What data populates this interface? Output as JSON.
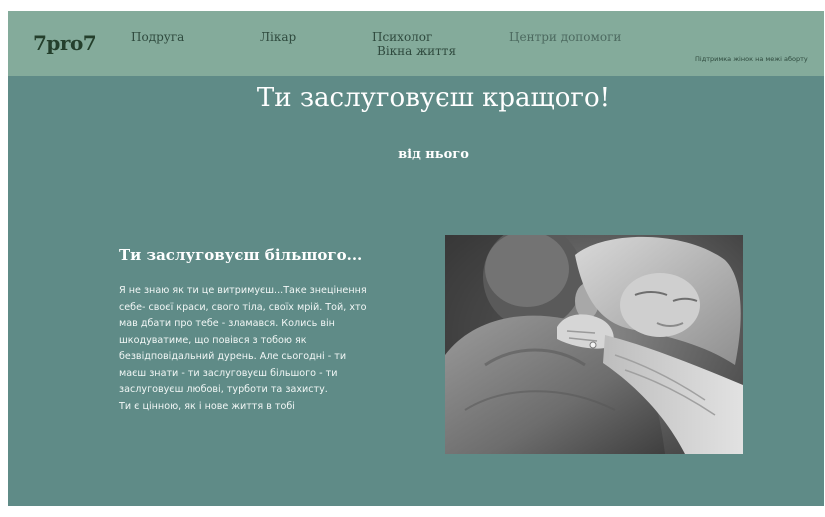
{
  "header": {
    "logo": "7pro7",
    "nav": {
      "friend": "Подруга",
      "doctor": "Лікар",
      "psychologist": "Психолог",
      "windows_of_life": "Вікна життя",
      "help_centers": "Центри допомоги",
      "support": "Підтримка жінок на межі аборту"
    }
  },
  "hero": {
    "title": "Ти заслуговуєш кращого!",
    "subtitle": "від нього"
  },
  "content": {
    "heading": "Ти заслуговуєш більшого...",
    "paragraph": "Я не знаю як ти це витримуєш...Таке знецінення себе- своєї краси, свого тіла, своїх мрій. Той, хто мав дбати про тебе - зламався. Колись він шкодуватиме, що повівся з тобою як безвідповідальний дурень. Але сьогодні - ти маєш знати - ти заслуговуєш більшого - ти заслуговуєш любові, турботи та захисту.",
    "closing": "Ти є цінною, як і нове життя в тобі"
  },
  "colors": {
    "page_background": "#5f8b87",
    "header_background": "#84ab9b",
    "logo": "#243f2c",
    "text_light": "#ffffff"
  },
  "image": {
    "icon": "couple-hugging-photo"
  }
}
